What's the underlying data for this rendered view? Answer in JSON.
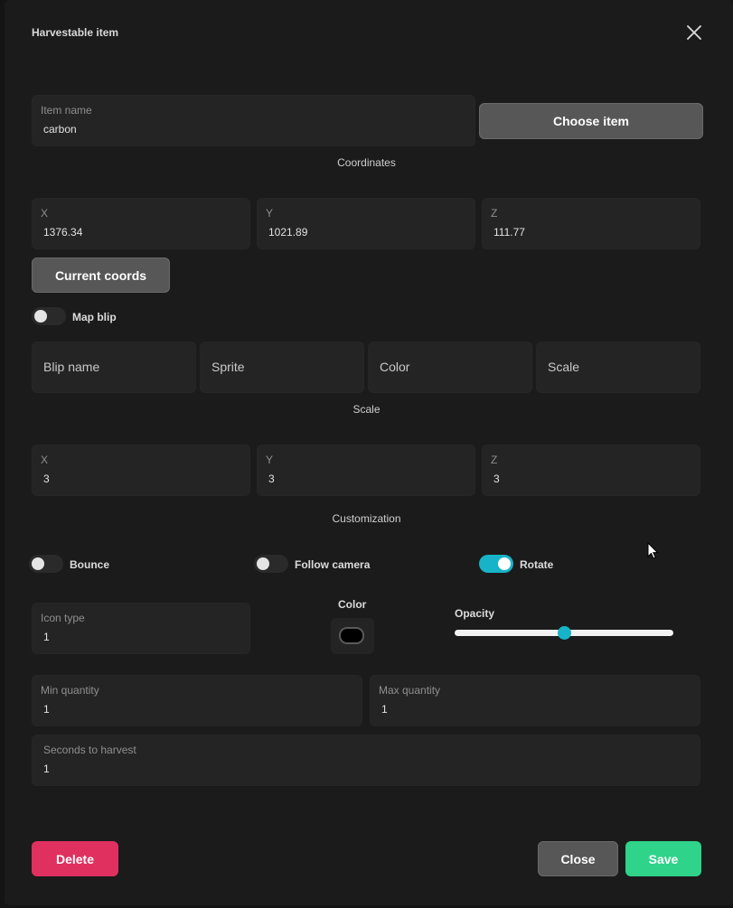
{
  "dialog": {
    "title": "Harvestable item"
  },
  "item": {
    "label": "Item name",
    "value": "carbon",
    "choose_label": "Choose item"
  },
  "coordinates": {
    "heading": "Coordinates",
    "x": {
      "label": "X",
      "value": "1376.34"
    },
    "y": {
      "label": "Y",
      "value": "1021.89"
    },
    "z": {
      "label": "Z",
      "value": "111.77"
    },
    "current_label": "Current coords"
  },
  "map_blip": {
    "label": "Map blip",
    "enabled": false,
    "fields": [
      {
        "placeholder": "Blip name"
      },
      {
        "placeholder": "Sprite"
      },
      {
        "placeholder": "Color"
      },
      {
        "placeholder": "Scale"
      }
    ]
  },
  "scale": {
    "heading": "Scale",
    "x": {
      "label": "X",
      "value": "3"
    },
    "y": {
      "label": "Y",
      "value": "3"
    },
    "z": {
      "label": "Z",
      "value": "3"
    }
  },
  "customization": {
    "heading": "Customization",
    "bounce": {
      "label": "Bounce",
      "enabled": false
    },
    "follow_camera": {
      "label": "Follow camera",
      "enabled": false
    },
    "rotate": {
      "label": "Rotate",
      "enabled": true
    },
    "icon_type": {
      "label": "Icon type",
      "value": "1"
    },
    "color": {
      "label": "Color",
      "value": "#000000"
    },
    "opacity": {
      "label": "Opacity",
      "fraction": 0.5
    }
  },
  "quantity": {
    "min": {
      "label": "Min quantity",
      "value": "1"
    },
    "max": {
      "label": "Max quantity",
      "value": "1"
    },
    "seconds": {
      "label": "Seconds to harvest",
      "value": "1"
    }
  },
  "actions": {
    "delete_label": "Delete",
    "close_label": "Close",
    "save_label": "Save"
  },
  "colors": {
    "accent": "#17b3c8",
    "delete": "#e0305f",
    "save": "#2fd38a"
  }
}
